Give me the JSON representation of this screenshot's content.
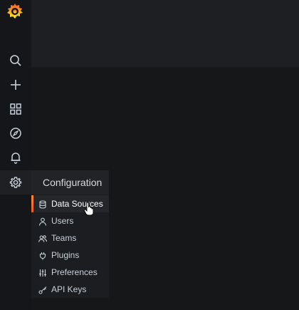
{
  "sidebar": {
    "icons": [
      "grafana-logo-icon",
      "search-icon",
      "plus-icon",
      "dashboards-icon",
      "compass-icon",
      "bell-icon",
      "gear-icon"
    ]
  },
  "config_menu": {
    "title": "Configuration",
    "items": [
      {
        "label": "Data Sources",
        "icon": "database-icon",
        "active": true
      },
      {
        "label": "Users",
        "icon": "user-icon",
        "active": false
      },
      {
        "label": "Teams",
        "icon": "users-icon",
        "active": false
      },
      {
        "label": "Plugins",
        "icon": "plug-icon",
        "active": false
      },
      {
        "label": "Preferences",
        "icon": "sliders-icon",
        "active": false
      },
      {
        "label": "API Keys",
        "icon": "key-icon",
        "active": false
      }
    ]
  },
  "colors": {
    "accent": "#f05a28",
    "sidebar_bg": "#141619",
    "menu_bg": "#1c1d20"
  }
}
